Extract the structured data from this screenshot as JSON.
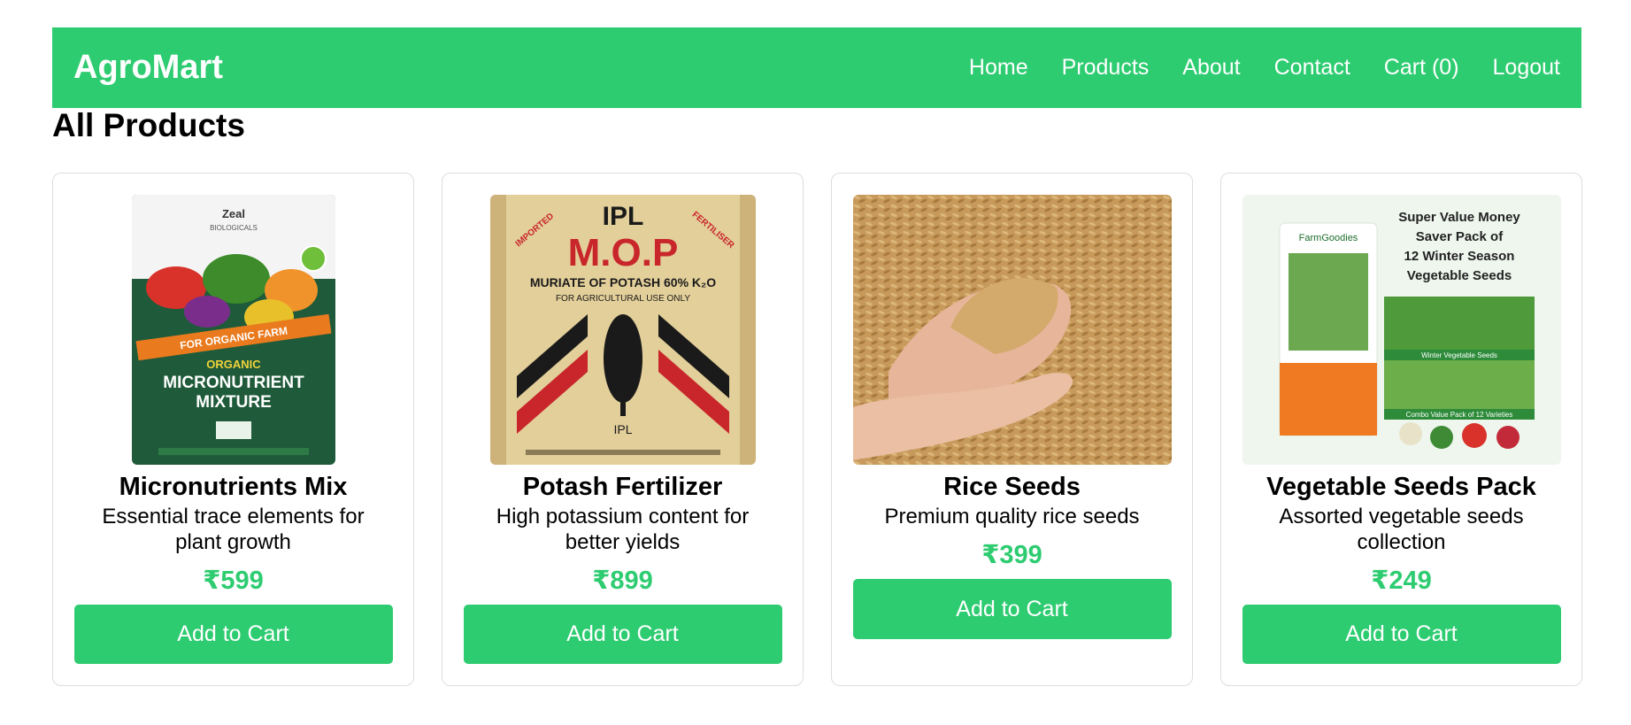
{
  "header": {
    "brand": "AgroMart",
    "nav": [
      "Home",
      "Products",
      "About",
      "Contact",
      "Cart (0)",
      "Logout"
    ]
  },
  "page": {
    "title": "All Products"
  },
  "products": [
    {
      "name": "Micronutrients Mix",
      "description": "Essential trace elements for plant growth",
      "price": "₹599",
      "button": "Add to Cart",
      "image": {
        "kind": "bag",
        "lines": [
          "Zeal",
          "BIOLOGICALS",
          "FOR ORGANIC FARM",
          "ORGANIC",
          "MICRONUTRIENT",
          "MIXTURE"
        ]
      }
    },
    {
      "name": "Potash Fertilizer",
      "description": "High potassium content for better yields",
      "price": "₹899",
      "button": "Add to Cart",
      "image": {
        "kind": "sack",
        "lines": [
          "IPL",
          "M.O.P",
          "MURIATE OF POTASH 60% K₂O",
          "FOR AGRICULTURAL USE ONLY",
          "IMPORTED",
          "FERTILISER",
          "IPL"
        ]
      }
    },
    {
      "name": "Rice Seeds",
      "description": "Premium quality rice seeds",
      "price": "₹399",
      "button": "Add to Cart",
      "image": {
        "kind": "photo"
      }
    },
    {
      "name": "Vegetable Seeds Pack",
      "description": "Assorted vegetable seeds collection",
      "price": "₹249",
      "button": "Add to Cart",
      "image": {
        "kind": "pack",
        "lines": [
          "Super Value Money",
          "Saver Pack of",
          "12 Winter Season",
          "Vegetable Seeds",
          "FarmGoodies",
          "Winter Vegetable Seeds",
          "Combo Value Pack of 12 Varieties"
        ]
      }
    }
  ]
}
